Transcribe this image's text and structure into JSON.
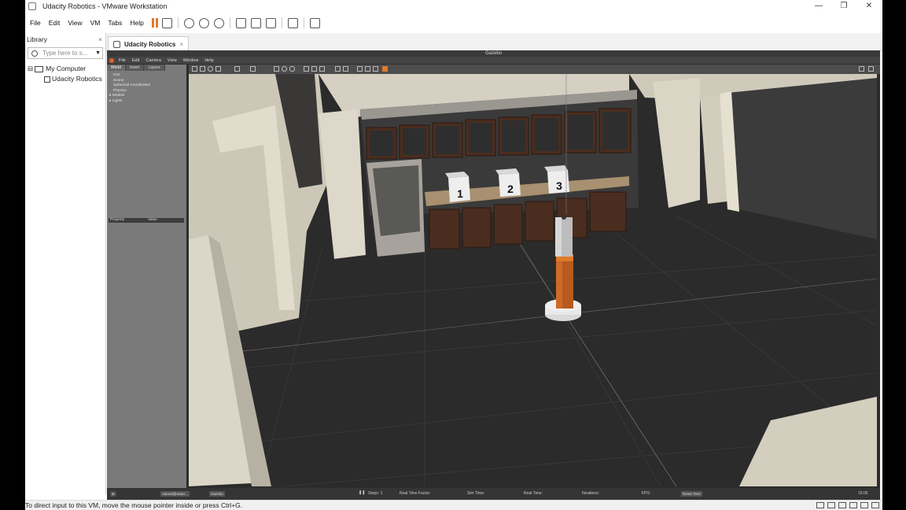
{
  "window": {
    "title": "Udacity Robotics - VMware Workstation",
    "controls": {
      "minimize": "—",
      "restore": "❐",
      "close": "✕"
    }
  },
  "menubar": {
    "items": [
      "File",
      "Edit",
      "View",
      "VM",
      "Tabs",
      "Help"
    ],
    "accent_color": "#e07a2b"
  },
  "library": {
    "title": "Library",
    "close": "×",
    "search_placeholder": "Type here to s...",
    "tree": [
      {
        "label": "My Computer",
        "expander": "⊟"
      },
      {
        "label": "Udacity Robotics"
      }
    ]
  },
  "tabs": [
    {
      "label": "Udacity Robotics",
      "close": "×"
    }
  ],
  "gazebo": {
    "title": "Gazebo",
    "menu": [
      "File",
      "Edit",
      "Camera",
      "View",
      "Window",
      "Help"
    ],
    "panel_tabs": [
      "World",
      "Insert",
      "Layers"
    ],
    "world_tree": [
      "GUI",
      "Scene",
      "Spherical Coordinates",
      "Physics",
      "Models",
      "Lights"
    ],
    "property_headers": [
      "Property",
      "Value"
    ],
    "shelf_labels": [
      "1",
      "2",
      "3"
    ],
    "taskbar": [
      "robond@udaci...",
      "Gazebo"
    ],
    "status_items": [
      "Steps: 1",
      "Real Time Factor:",
      "Sim Time:",
      "Real Time:",
      "Iterations:",
      "FPS:",
      "Reset Time"
    ],
    "clock": "15:05"
  },
  "statusbar": {
    "message": "To direct input to this VM, move the mouse pointer inside or press Ctrl+G."
  },
  "colors": {
    "floor": "#2b2b2b",
    "walls": "#d8d2c4",
    "cabinet": "#3e2418",
    "robot_link": "#b85a1e",
    "robot_joint": "#e07a2b"
  }
}
